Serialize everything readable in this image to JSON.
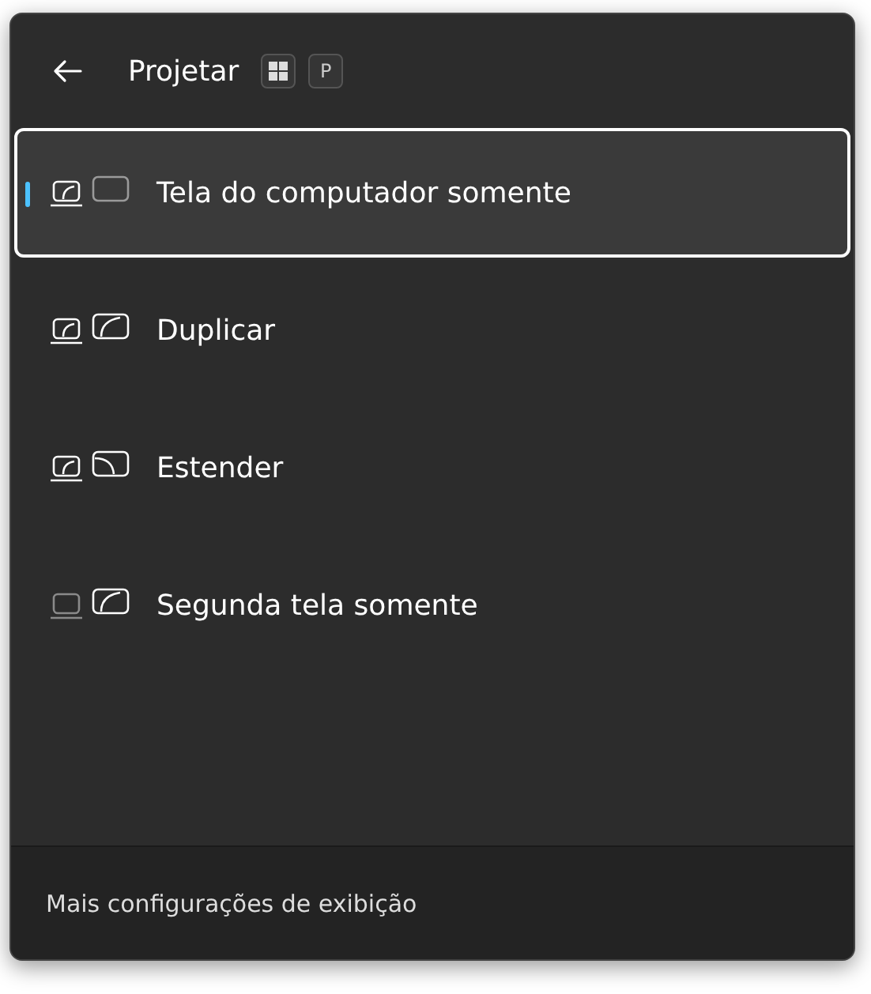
{
  "panel": {
    "title": "Projetar",
    "shortcut_keys": [
      {
        "kind": "windows-logo"
      },
      {
        "kind": "letter",
        "label": "P"
      }
    ]
  },
  "options": [
    {
      "kind": "pc-only",
      "label": "Tela do computador somente",
      "selected": true
    },
    {
      "kind": "duplicate",
      "label": "Duplicar",
      "selected": false
    },
    {
      "kind": "extend",
      "label": "Estender",
      "selected": false
    },
    {
      "kind": "second-only",
      "label": "Segunda tela somente",
      "selected": false
    }
  ],
  "footer": {
    "link": "Mais configurações de exibição"
  }
}
